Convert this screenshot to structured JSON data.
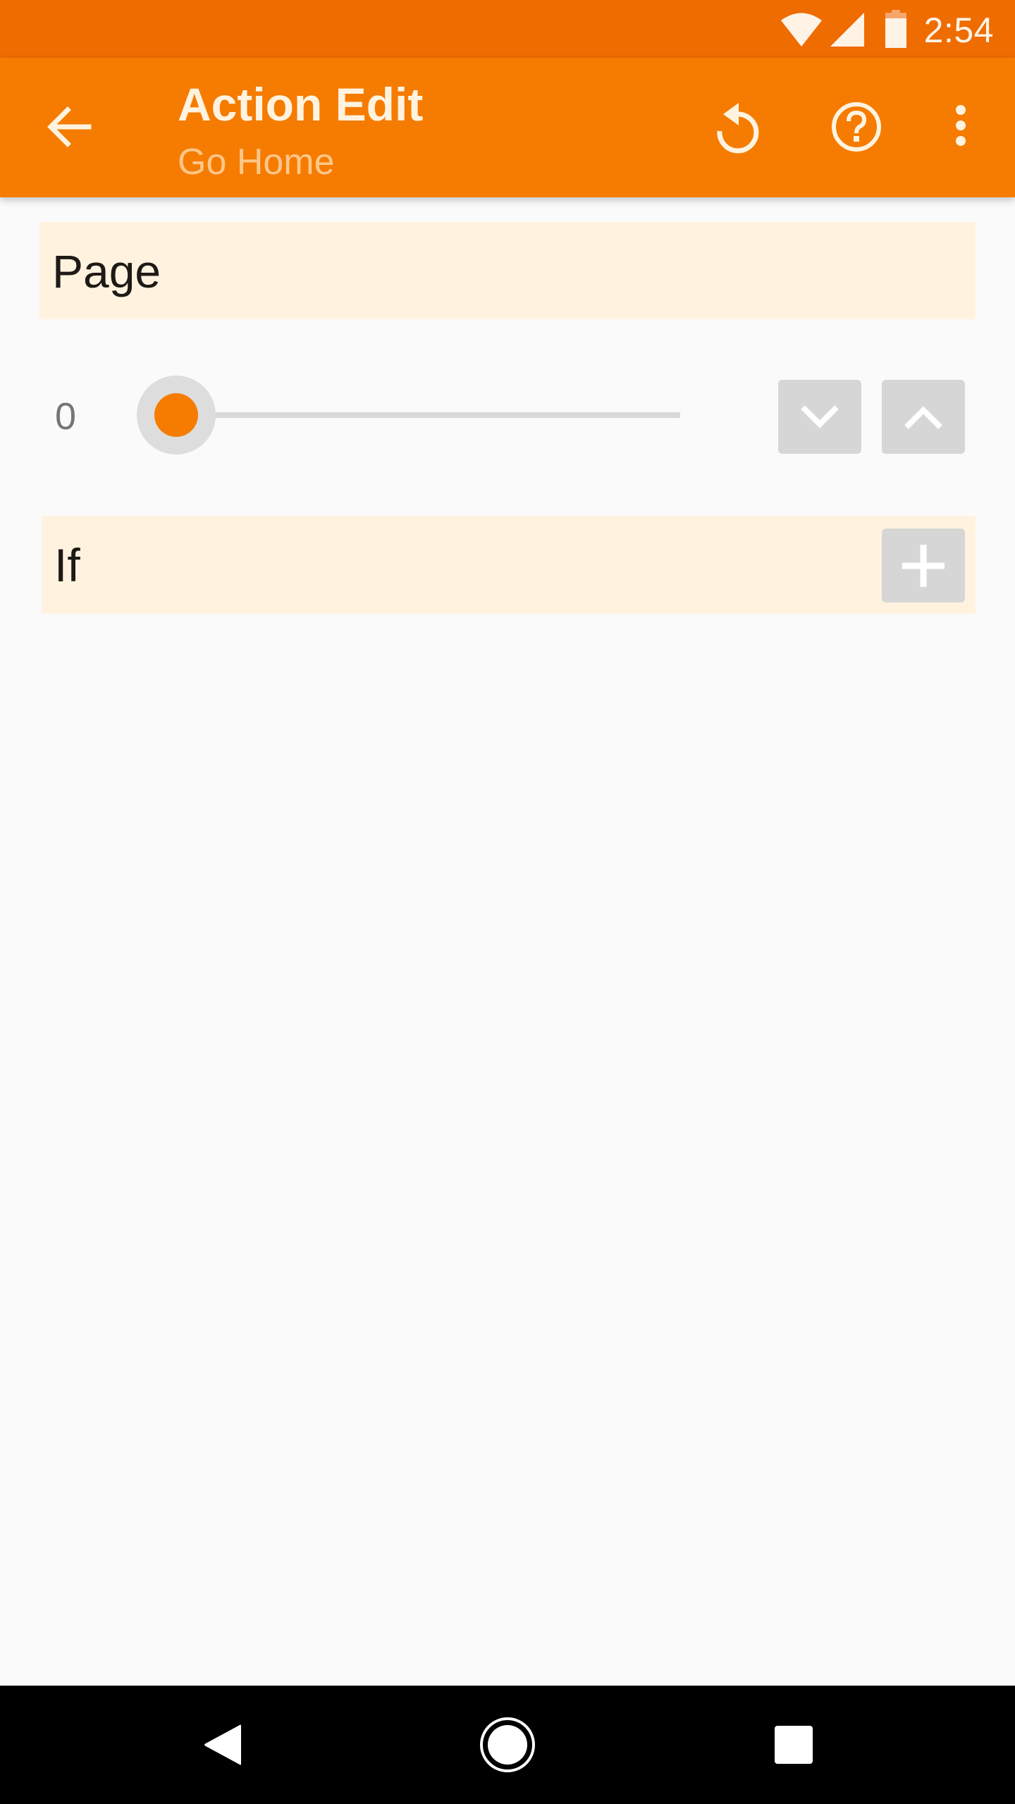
{
  "status_bar": {
    "time": "2:54",
    "icons": [
      "wifi-icon",
      "cell-signal-icon",
      "battery-icon"
    ]
  },
  "toolbar": {
    "title": "Action Edit",
    "subtitle": "Go Home",
    "back_icon": "arrow-left-icon",
    "actions": [
      {
        "name": "reset",
        "icon": "undo-icon"
      },
      {
        "name": "help",
        "icon": "help-circle-icon"
      },
      {
        "name": "more",
        "icon": "more-vert-icon"
      }
    ]
  },
  "page_section": {
    "label": "Page",
    "slider": {
      "value_text": "0",
      "value": 0,
      "fraction": 0.0
    },
    "buttons": [
      {
        "name": "decrement",
        "icon": "chevron-down-icon"
      },
      {
        "name": "increment",
        "icon": "chevron-up-icon"
      }
    ]
  },
  "if_section": {
    "label": "If",
    "add_icon": "plus-icon"
  },
  "nav_bar": {
    "buttons": [
      "back",
      "home",
      "recents"
    ]
  },
  "colors": {
    "status_bar": "#EE6C00",
    "toolbar": "#F57C00",
    "accent": "#F57C00",
    "section_bg": "#FFF3E0",
    "button_grey": "#D6D6D6",
    "background": "#FAFAFA"
  }
}
